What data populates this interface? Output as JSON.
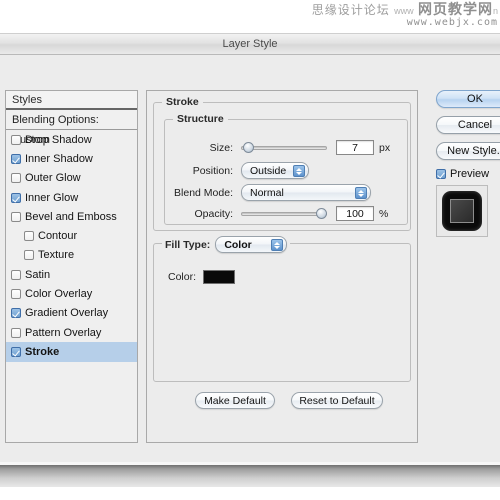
{
  "watermark": {
    "line1_cn": "思缘设计论坛",
    "line1_www": "www",
    "line1_site": "网页教学网",
    "line1_tail": "n",
    "line2": "www.webjx.com"
  },
  "window": {
    "title": "Layer Style"
  },
  "styles_panel": {
    "header": "Styles",
    "blending_options": "Blending Options: Custom",
    "effects": [
      {
        "label": "Drop Shadow",
        "checked": false,
        "indent": false,
        "selected": false
      },
      {
        "label": "Inner Shadow",
        "checked": true,
        "indent": false,
        "selected": false
      },
      {
        "label": "Outer Glow",
        "checked": false,
        "indent": false,
        "selected": false
      },
      {
        "label": "Inner Glow",
        "checked": true,
        "indent": false,
        "selected": false
      },
      {
        "label": "Bevel and Emboss",
        "checked": false,
        "indent": false,
        "selected": false
      },
      {
        "label": "Contour",
        "checked": false,
        "indent": true,
        "selected": false
      },
      {
        "label": "Texture",
        "checked": false,
        "indent": true,
        "selected": false
      },
      {
        "label": "Satin",
        "checked": false,
        "indent": false,
        "selected": false
      },
      {
        "label": "Color Overlay",
        "checked": false,
        "indent": false,
        "selected": false
      },
      {
        "label": "Gradient Overlay",
        "checked": true,
        "indent": false,
        "selected": false
      },
      {
        "label": "Pattern Overlay",
        "checked": false,
        "indent": false,
        "selected": false
      },
      {
        "label": "Stroke",
        "checked": true,
        "indent": false,
        "selected": true
      }
    ],
    "selection_color": "#b6cfe9"
  },
  "stroke": {
    "group_title": "Stroke",
    "structure_title": "Structure",
    "size_label": "Size:",
    "size_value": "7",
    "size_unit": "px",
    "size_slider_percent": 3,
    "position_label": "Position:",
    "position_value": "Outside",
    "blend_mode_label": "Blend Mode:",
    "blend_mode_value": "Normal",
    "opacity_label": "Opacity:",
    "opacity_value": "100",
    "opacity_unit": "%",
    "opacity_slider_percent": 100
  },
  "fill": {
    "fill_type_label": "Fill Type:",
    "fill_type_value": "Color",
    "color_label": "Color:",
    "color_value": "#090909"
  },
  "footer_buttons": {
    "make_default": "Make Default",
    "reset_to_default": "Reset to Default"
  },
  "right_panel": {
    "ok": "OK",
    "cancel": "Cancel",
    "new_style": "New Style..",
    "preview_label": "Preview",
    "preview_checked": true
  }
}
